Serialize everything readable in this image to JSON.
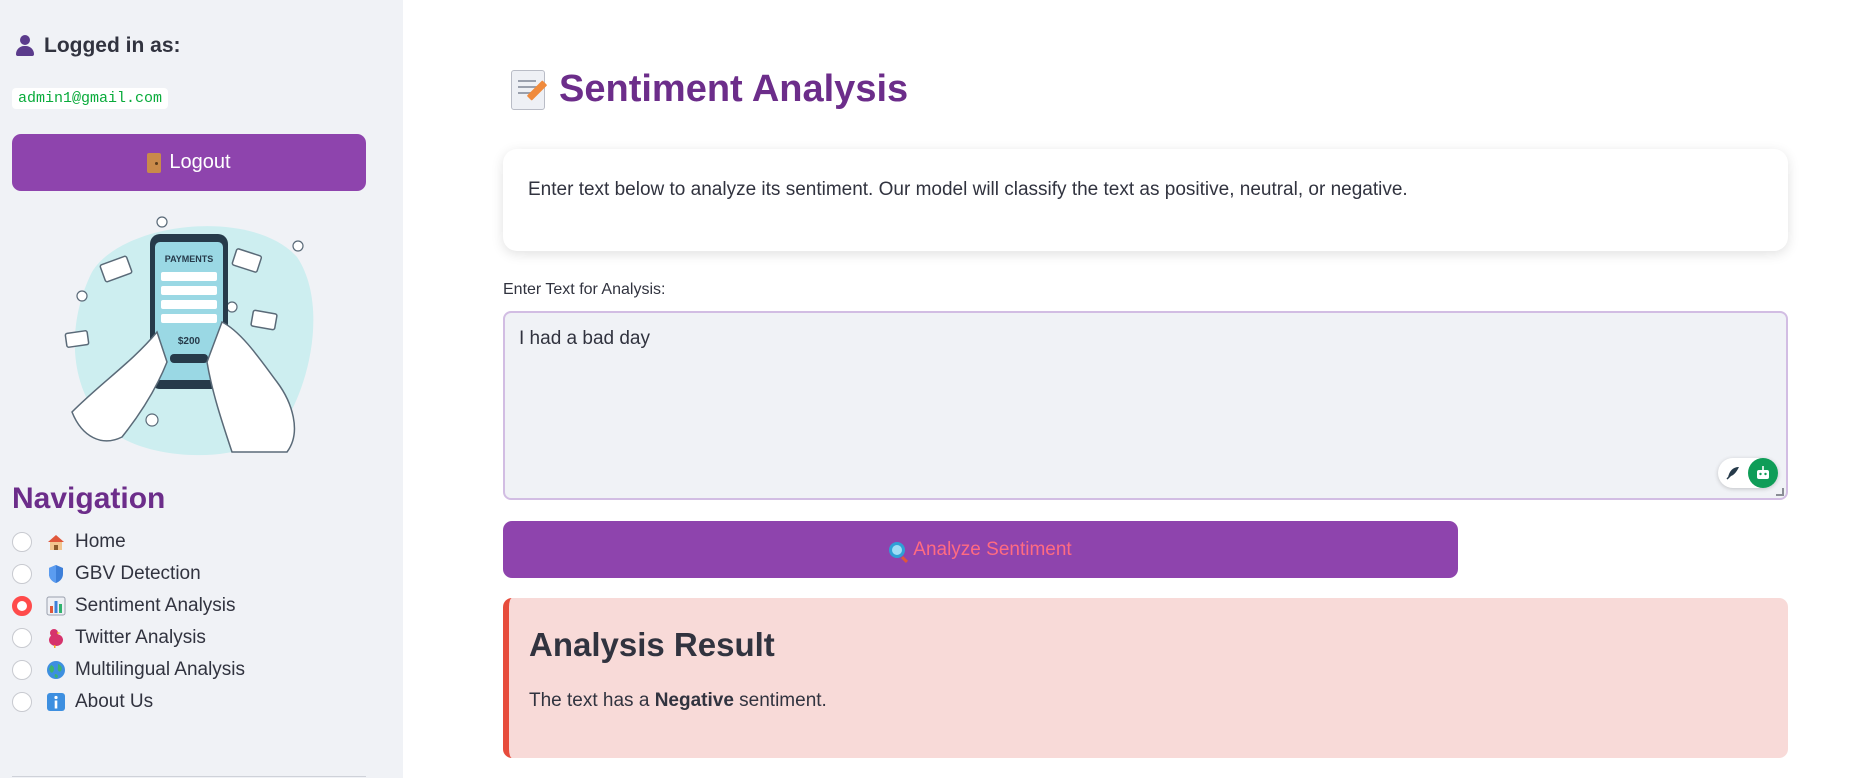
{
  "sidebar": {
    "logged_in_label": "Logged in as:",
    "user_email": "admin1@gmail.com",
    "logout_label": "Logout",
    "illustration_text": "PAYMENTS",
    "illustration_amount": "$200",
    "nav_title": "Navigation",
    "nav_items": [
      {
        "label": "Home",
        "icon": "house-icon",
        "selected": false
      },
      {
        "label": "GBV Detection",
        "icon": "shield-icon",
        "selected": false
      },
      {
        "label": "Sentiment Analysis",
        "icon": "bar-chart-icon",
        "selected": true
      },
      {
        "label": "Twitter Analysis",
        "icon": "bird-icon",
        "selected": false
      },
      {
        "label": "Multilingual Analysis",
        "icon": "globe-icon",
        "selected": false
      },
      {
        "label": "About Us",
        "icon": "info-icon",
        "selected": false
      }
    ]
  },
  "main": {
    "title": "Sentiment Analysis",
    "intro": "Enter text below to analyze its sentiment. Our model will classify the text as positive, neutral, or negative.",
    "input_label": "Enter Text for Analysis:",
    "input_value": "I had a bad day",
    "analyze_label": "Analyze Sentiment",
    "result": {
      "title": "Analysis Result",
      "prefix": "The text has a ",
      "sentiment": "Negative",
      "suffix": " sentiment."
    }
  },
  "colors": {
    "accent": "#8e44ad",
    "title": "#6c2d8a",
    "sidebar_bg": "#f0f2f6",
    "result_bg": "#f8dad8",
    "result_border": "#e74c3c",
    "radio_selected": "#ff4b4b"
  }
}
